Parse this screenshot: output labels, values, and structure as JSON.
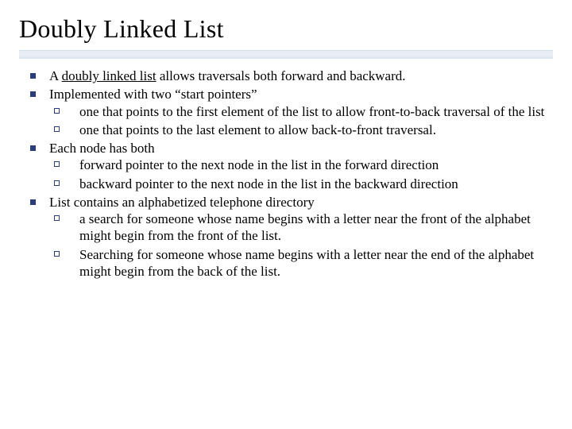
{
  "slide": {
    "title": "Doubly Linked List",
    "bullets": [
      {
        "text_parts": [
          {
            "t": "A ",
            "u": false
          },
          {
            "t": "doubly linked list",
            "u": true
          },
          {
            "t": " allows traversals both forward and backward.",
            "u": false
          }
        ]
      },
      {
        "text_parts": [
          {
            "t": "Implemented with two “start pointers”",
            "u": false
          }
        ],
        "sub": [
          "one that points to the first element of the list to allow front-to-back traversal of the list",
          "one that points to the last element to allow back-to-front traversal."
        ]
      },
      {
        "text_parts": [
          {
            "t": "Each node has both",
            "u": false
          }
        ],
        "sub": [
          "forward pointer to the next node in the list in the forward direction",
          "backward pointer to the next node in the list in the backward direction"
        ]
      },
      {
        "text_parts": [
          {
            "t": "List contains an alphabetized telephone directory",
            "u": false
          }
        ],
        "sub": [
          "a search for someone whose name begins with a letter near the front of the alphabet might begin from the front of the list.",
          "Searching for someone whose name begins with a letter near the end of the alphabet might begin from the back of the list."
        ]
      }
    ]
  }
}
